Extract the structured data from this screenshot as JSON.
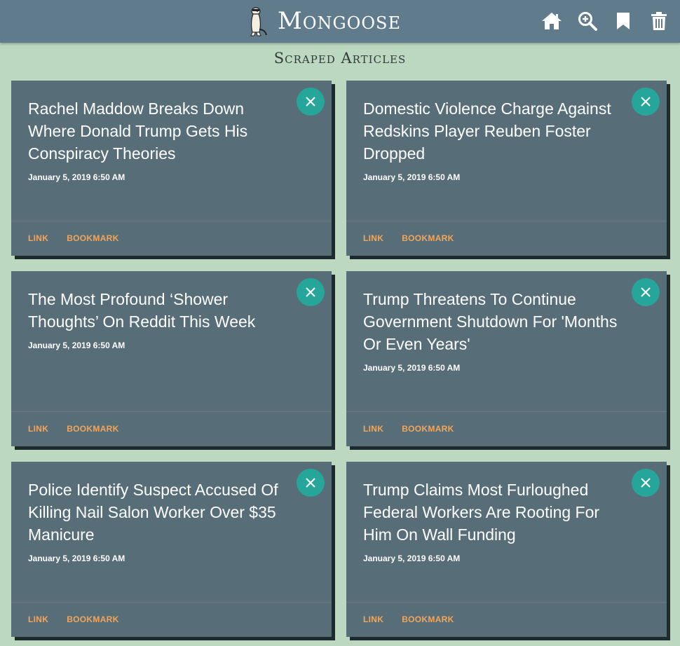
{
  "navbar": {
    "brand": "Mongoose",
    "icons": [
      "home-icon",
      "zoom-in-icon",
      "bookmark-icon",
      "trash-icon"
    ]
  },
  "page": {
    "title": "Scraped Articles"
  },
  "colors": {
    "background": "#bcd8c1",
    "navbar": "#5f7b8c",
    "card": "#576d78",
    "accent": "#26a69a",
    "action_text": "#f2a65a"
  },
  "articles": [
    {
      "title": "Rachel Maddow Breaks Down Where Donald Trump Gets His Conspiracy Theories",
      "date": "January 5, 2019 6:50 AM",
      "link_label": "LINK",
      "bookmark_label": "BOOKMARK"
    },
    {
      "title": "Domestic Violence Charge Against Redskins Player Reuben Foster Dropped",
      "date": "January 5, 2019 6:50 AM",
      "link_label": "LINK",
      "bookmark_label": "BOOKMARK"
    },
    {
      "title": "The Most Profound ‘Shower Thoughts’ On Reddit This Week",
      "date": "January 5, 2019 6:50 AM",
      "link_label": "LINK",
      "bookmark_label": "BOOKMARK"
    },
    {
      "title": "Trump Threatens To Continue Government Shutdown For 'Months Or Even Years'",
      "date": "January 5, 2019 6:50 AM",
      "link_label": "LINK",
      "bookmark_label": "BOOKMARK"
    },
    {
      "title": "Police Identify Suspect Accused Of Killing Nail Salon Worker Over $35 Manicure",
      "date": "January 5, 2019 6:50 AM",
      "link_label": "LINK",
      "bookmark_label": "BOOKMARK"
    },
    {
      "title": "Trump Claims Most Furloughed Federal Workers Are Rooting For Him On Wall Funding",
      "date": "January 5, 2019 6:50 AM",
      "link_label": "LINK",
      "bookmark_label": "BOOKMARK"
    }
  ]
}
